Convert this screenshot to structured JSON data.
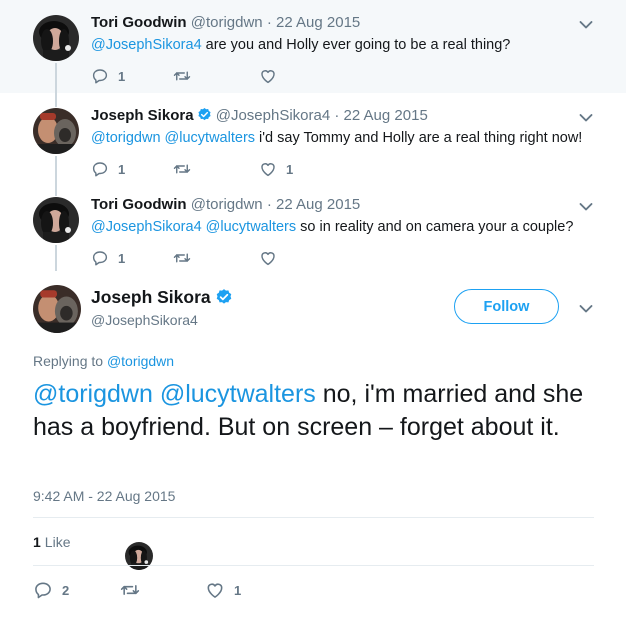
{
  "thread": [
    {
      "name": "Tori Goodwin",
      "handle": "@torigdwn",
      "separator": "·",
      "date": "22 Aug 2015",
      "verified": false,
      "mentions": "@JosephSikora4",
      "text": "  are you and Holly ever going to be a real thing?",
      "replies": "1",
      "retweets": "",
      "likes": ""
    },
    {
      "name": "Joseph Sikora",
      "handle": "@JosephSikora4",
      "separator": "·",
      "date": "22 Aug 2015",
      "verified": true,
      "mentions": "@torigdwn @lucytwalters",
      "text": " i'd say Tommy and Holly are a real thing right now!",
      "replies": "1",
      "retweets": "",
      "likes": "1"
    },
    {
      "name": "Tori Goodwin",
      "handle": "@torigdwn",
      "separator": "·",
      "date": "22 Aug 2015",
      "verified": false,
      "mentions": "@JosephSikora4 @lucytwalters",
      "text": " so in reality and on camera your a couple?",
      "replies": "1",
      "retweets": "",
      "likes": ""
    }
  ],
  "main": {
    "name": "Joseph Sikora",
    "handle": "@JosephSikora4",
    "verified": true,
    "follow_label": "Follow",
    "replying_prefix": "Replying to ",
    "replying_to": "@torigdwn",
    "mentions": "@torigdwn @lucytwalters",
    "text": " no, i'm married and she has a boyfriend. But on screen – forget about it.",
    "timestamp": "9:42 AM - 22 Aug 2015",
    "like_count": "1",
    "like_label": "Like",
    "replies": "2",
    "retweets": "",
    "likes": "1"
  },
  "colors": {
    "accent": "#1da1f2",
    "link": "#1b95e0",
    "muted": "#657786",
    "context_bg": "#f5f8fa"
  },
  "icons": [
    "reply-icon",
    "retweet-icon",
    "like-icon",
    "verified-badge-icon",
    "chevron-down-icon"
  ]
}
